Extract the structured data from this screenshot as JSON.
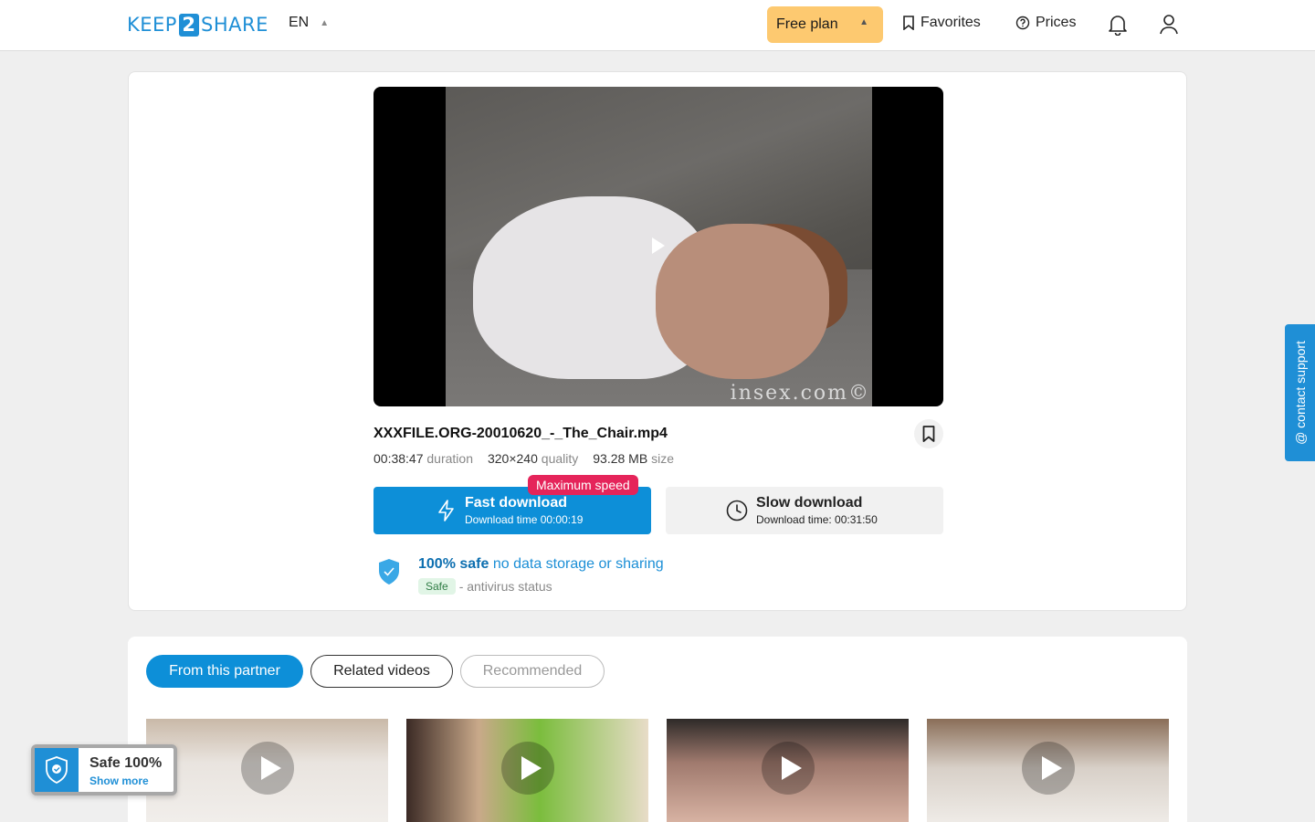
{
  "header": {
    "logo_left": "KEEP",
    "logo_mid": "2",
    "logo_right": "SHARE",
    "language": "EN",
    "plan_label": "Free plan",
    "favorites_label": "Favorites",
    "prices_label": "Prices"
  },
  "video": {
    "watermark": "insex.com©",
    "file_name": "XXXFILE.ORG-20010620_-_The_Chair.mp4",
    "duration_value": "00:38:47",
    "duration_label": "duration",
    "quality_value": "320×240",
    "quality_label": "quality",
    "size_value": "93.28 MB",
    "size_label": "size"
  },
  "download": {
    "fast_label": "Fast download",
    "fast_time": "Download time 00:00:19",
    "max_speed_badge": "Maximum speed",
    "slow_label": "Slow download",
    "slow_time": "Download time: 00:31:50"
  },
  "safety": {
    "safe_strong": "100% safe",
    "safe_rest": "no data storage or sharing",
    "status_chip": "Safe",
    "status_text": "- antivirus status"
  },
  "support_tab": "@ contact support",
  "related": {
    "tabs": [
      "From this partner",
      "Related videos",
      "Recommended"
    ]
  },
  "safe_widget": {
    "title": "Safe 100%",
    "link": "Show more"
  },
  "colors": {
    "accent": "#0d8fd8",
    "plan": "#fdc970",
    "badge": "#e5245a"
  }
}
